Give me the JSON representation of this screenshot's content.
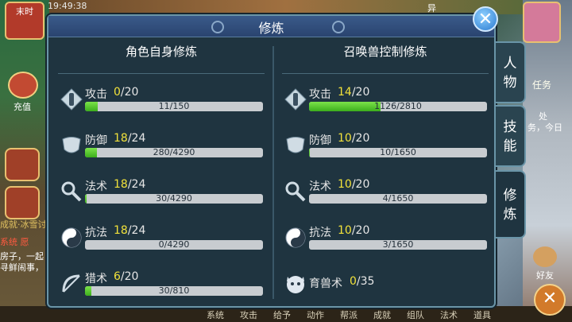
{
  "background": {
    "time_label": "末时",
    "clock": "19:49:38",
    "top_right_text": "异",
    "recharge_label": "充值",
    "left_texts": [
      "成就·冰雪讨",
      "系统",
      "愿",
      "房子，一起",
      "寻鲜闹事，"
    ],
    "quest_label": "任务",
    "quest_texts": [
      "处",
      "务，今日"
    ],
    "friends_label": "好友",
    "bottom_menu": [
      "系统",
      "攻击",
      "给予",
      "动作",
      "帮派",
      "成就",
      "组队",
      "法术",
      "道具"
    ]
  },
  "dialog": {
    "title": "修炼",
    "close_label": "✕",
    "left_panel": {
      "title": "角色自身修炼",
      "rows": [
        {
          "name": "攻击",
          "cur": "0",
          "max": "/20",
          "bar_text": "11/150",
          "progress": 0.073,
          "icon": "attack-icon"
        },
        {
          "name": "防御",
          "cur": "18",
          "max": "/24",
          "bar_text": "280/4290",
          "progress": 0.065,
          "icon": "defense-icon"
        },
        {
          "name": "法术",
          "cur": "18",
          "max": "/24",
          "bar_text": "30/4290",
          "progress": 0.007,
          "icon": "magic-icon"
        },
        {
          "name": "抗法",
          "cur": "18",
          "max": "/24",
          "bar_text": "0/4290",
          "progress": 0.0,
          "icon": "resist-icon"
        },
        {
          "name": "猎术",
          "cur": "6",
          "max": "/20",
          "bar_text": "30/810",
          "progress": 0.037,
          "icon": "hunt-icon"
        }
      ]
    },
    "right_panel": {
      "title": "召唤兽控制修炼",
      "rows": [
        {
          "name": "攻击",
          "cur": "14",
          "max": "/20",
          "bar_text": "1126/2810",
          "progress": 0.4,
          "icon": "attack-icon"
        },
        {
          "name": "防御",
          "cur": "10",
          "max": "/20",
          "bar_text": "10/1650",
          "progress": 0.006,
          "icon": "defense-icon"
        },
        {
          "name": "法术",
          "cur": "10",
          "max": "/20",
          "bar_text": "4/1650",
          "progress": 0.002,
          "icon": "magic-icon"
        },
        {
          "name": "抗法",
          "cur": "10",
          "max": "/20",
          "bar_text": "3/1650",
          "progress": 0.002,
          "icon": "resist-icon"
        },
        {
          "name": "育兽术",
          "cur": "0",
          "max": "/35",
          "bar_text": "",
          "progress": null,
          "icon": "beast-icon"
        }
      ]
    },
    "side_tabs": [
      "人物",
      "技能",
      "修炼"
    ]
  }
}
